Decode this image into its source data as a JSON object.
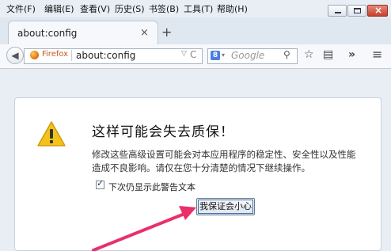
{
  "menubar": {
    "items": [
      {
        "label": "文件(F)"
      },
      {
        "label": "编辑(E)"
      },
      {
        "label": "查看(V)"
      },
      {
        "label": "历史(S)"
      },
      {
        "label": "书签(B)"
      },
      {
        "label": "工具(T)"
      },
      {
        "label": "帮助(H)"
      }
    ]
  },
  "tab": {
    "title": "about:config",
    "close_glyph": "×"
  },
  "newtab_glyph": "+",
  "urlbar": {
    "identity": "Firefox",
    "url": "about:config",
    "reload_glyph": "C",
    "drop_glyph": "▽"
  },
  "searchbar": {
    "engine_letter": "8",
    "placeholder": "Google",
    "go_glyph": "⚲"
  },
  "toolbar_icons": {
    "bookmark_star": "☆",
    "library": "▤",
    "overflow": "»",
    "menu": "≡"
  },
  "warning": {
    "title": "这样可能会失去质保！",
    "message": "修改这些高级设置可能会对本应用程序的稳定性、安全性以及性能造成不良影响。请仅在您十分清楚的情况下继续操作。",
    "checkbox_label": "下次仍显示此警告文本",
    "checkbox_checked": true,
    "accept_label": "我保证会小心"
  },
  "colors": {
    "accent_arrow": "#e8306a",
    "warning_yellow": "#f3c21b"
  }
}
